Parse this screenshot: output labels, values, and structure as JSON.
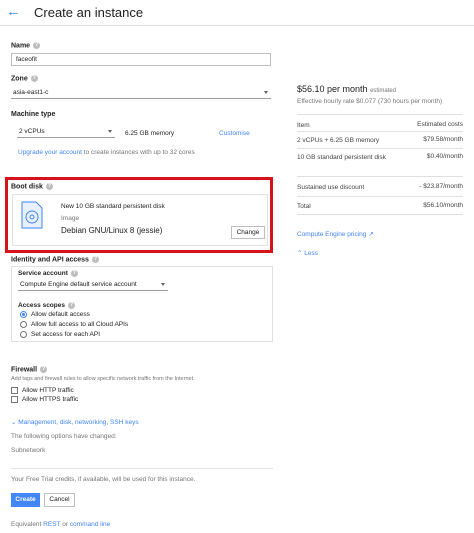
{
  "header": {
    "title": "Create an instance"
  },
  "name": {
    "label": "Name",
    "value": "faceofit"
  },
  "zone": {
    "label": "Zone",
    "value": "asia-east1-c"
  },
  "machine": {
    "label": "Machine type",
    "vcpu": "2 vCPUs",
    "memory": "6.25 GB memory",
    "customise": "Customise",
    "upgrade_link": "Upgrade your account",
    "upgrade_text": " to create instances with up to 32 cores"
  },
  "boot": {
    "label": "Boot disk",
    "disk_title": "New 10 GB standard persistent disk",
    "image_label": "Image",
    "image_value": "Debian GNU/Linux 8 (jessie)",
    "change": "Change"
  },
  "identity": {
    "label": "Identity and API access",
    "service_account_label": "Service account",
    "service_account_value": "Compute Engine default service account",
    "scopes_label": "Access scopes",
    "scopes": [
      "Allow default access",
      "Allow full access to all Cloud APIs",
      "Set access for each API"
    ]
  },
  "firewall": {
    "label": "Firewall",
    "desc": "Add tags and firewall rules to allow specific network traffic from the Internet.",
    "http": "Allow HTTP traffic",
    "https": "Allow HTTPS traffic"
  },
  "more": {
    "toggle": "Management, disk, networking, SSH keys",
    "changed": "The following options have changed:",
    "subnetwork": "Subnetwork"
  },
  "footer": {
    "trial": "Your Free Trial credits, if available, will be used for this instance.",
    "create": "Create",
    "cancel": "Cancel",
    "equiv_prefix": "Equivalent ",
    "rest": "REST",
    "or": " or ",
    "command": "command line"
  },
  "pricing": {
    "monthly": "$56.10 per month",
    "estimated": "estimated",
    "hourly": "Effective hourly rate $0.077 (730 hours per month)",
    "col_item": "Item",
    "col_cost": "Estimated costs",
    "rows": [
      {
        "item": "2 vCPUs + 6.25 GB memory",
        "cost": "$79.58/month"
      },
      {
        "item": "10 GB standard persistent disk",
        "cost": "$0.40/month"
      },
      {
        "item": "Sustained use discount",
        "cost": "- $23.87/month"
      },
      {
        "item": "Total",
        "cost": "$56.10/month"
      }
    ],
    "pricing_link": "Compute Engine pricing",
    "less": "Less"
  },
  "colors": {
    "accent": "#4285f4",
    "highlight": "#d8121a"
  },
  "icons": [
    "back-arrow-icon",
    "help-icon",
    "disk-icon",
    "external-link-icon",
    "chevron-up-icon",
    "chevron-down-icon"
  ]
}
